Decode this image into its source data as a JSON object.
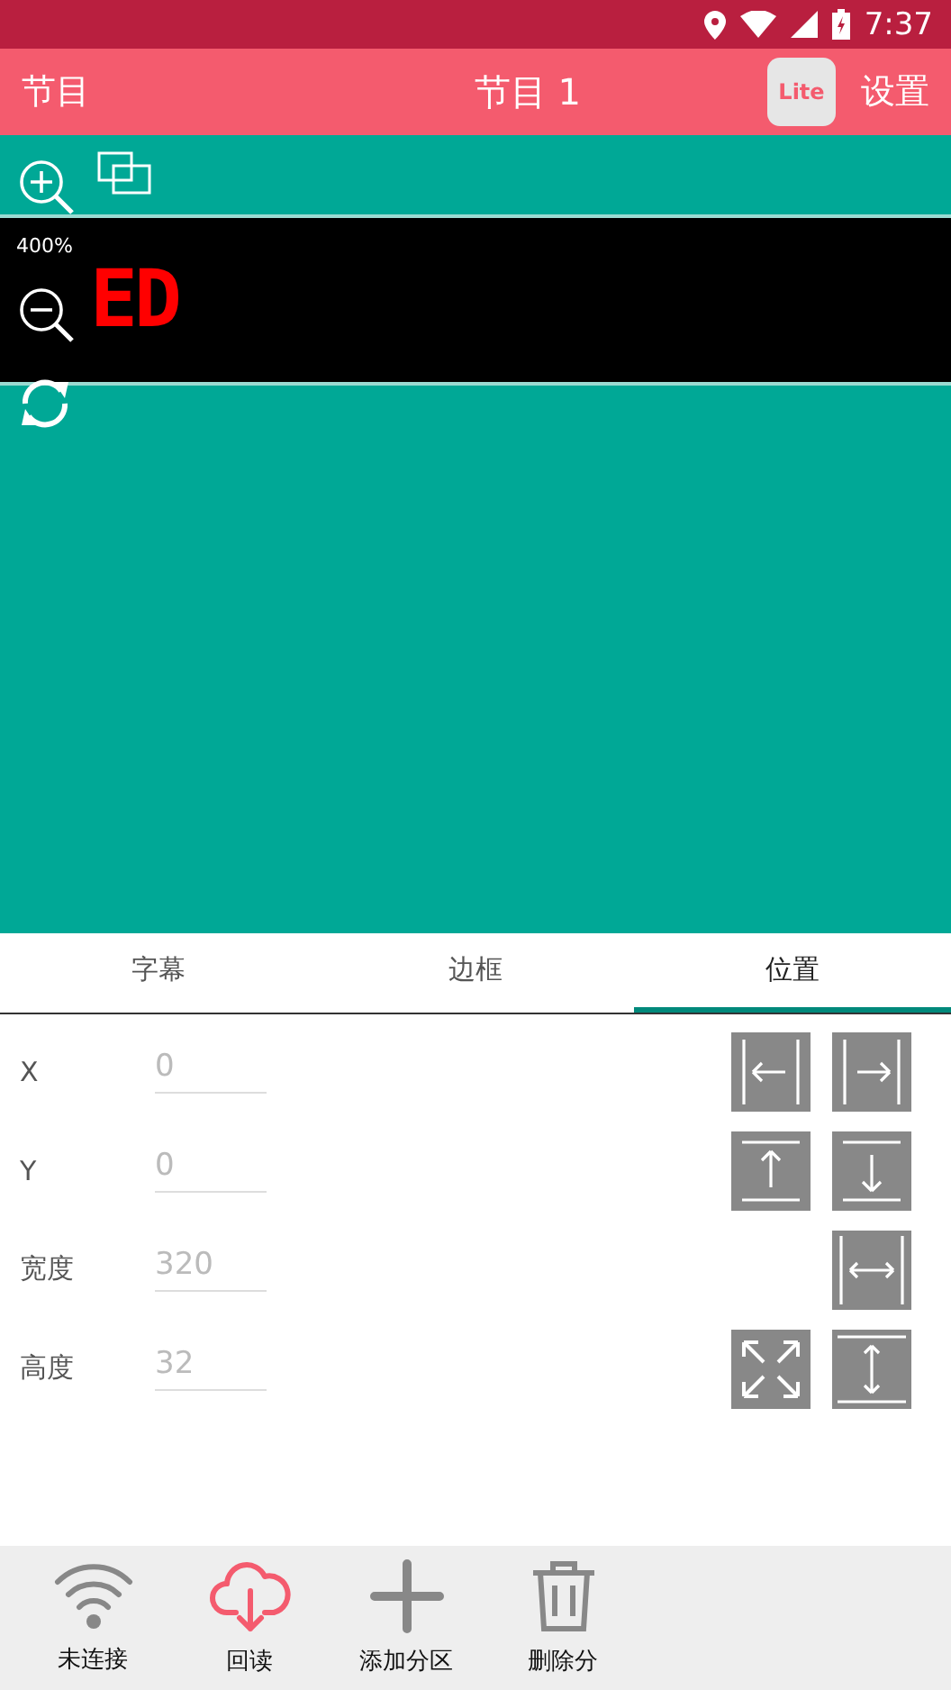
{
  "status_bar": {
    "time": "7:37"
  },
  "app_bar": {
    "left": "节目",
    "title": "节目 1",
    "badge": "Lite",
    "right": "设置"
  },
  "preview": {
    "zoom": "400%",
    "led_text": "ED"
  },
  "tabs": [
    {
      "label": "字幕",
      "selected": false
    },
    {
      "label": "边框",
      "selected": false
    },
    {
      "label": "位置",
      "selected": true
    }
  ],
  "fields": [
    {
      "label": "X",
      "placeholder": "0",
      "buttons": [
        {
          "kind": "align-left"
        },
        {
          "kind": "align-right"
        }
      ]
    },
    {
      "label": "Y",
      "placeholder": "0",
      "buttons": [
        {
          "kind": "align-top"
        },
        {
          "kind": "align-bottom"
        }
      ]
    },
    {
      "label": "宽度",
      "placeholder": "320",
      "buttons": [
        {
          "kind": "fill-width"
        }
      ]
    },
    {
      "label": "高度",
      "placeholder": "32",
      "buttons": [
        {
          "kind": "fullscreen"
        },
        {
          "kind": "fill-height"
        }
      ]
    }
  ],
  "bottom_bar": [
    {
      "kind": "wifi",
      "label": "未连接",
      "highlighted": false
    },
    {
      "kind": "cloud",
      "label": "回读",
      "highlighted": true
    },
    {
      "kind": "plus",
      "label": "添加分区",
      "highlighted": false
    },
    {
      "kind": "trash",
      "label": "删除分",
      "highlighted": false
    }
  ]
}
